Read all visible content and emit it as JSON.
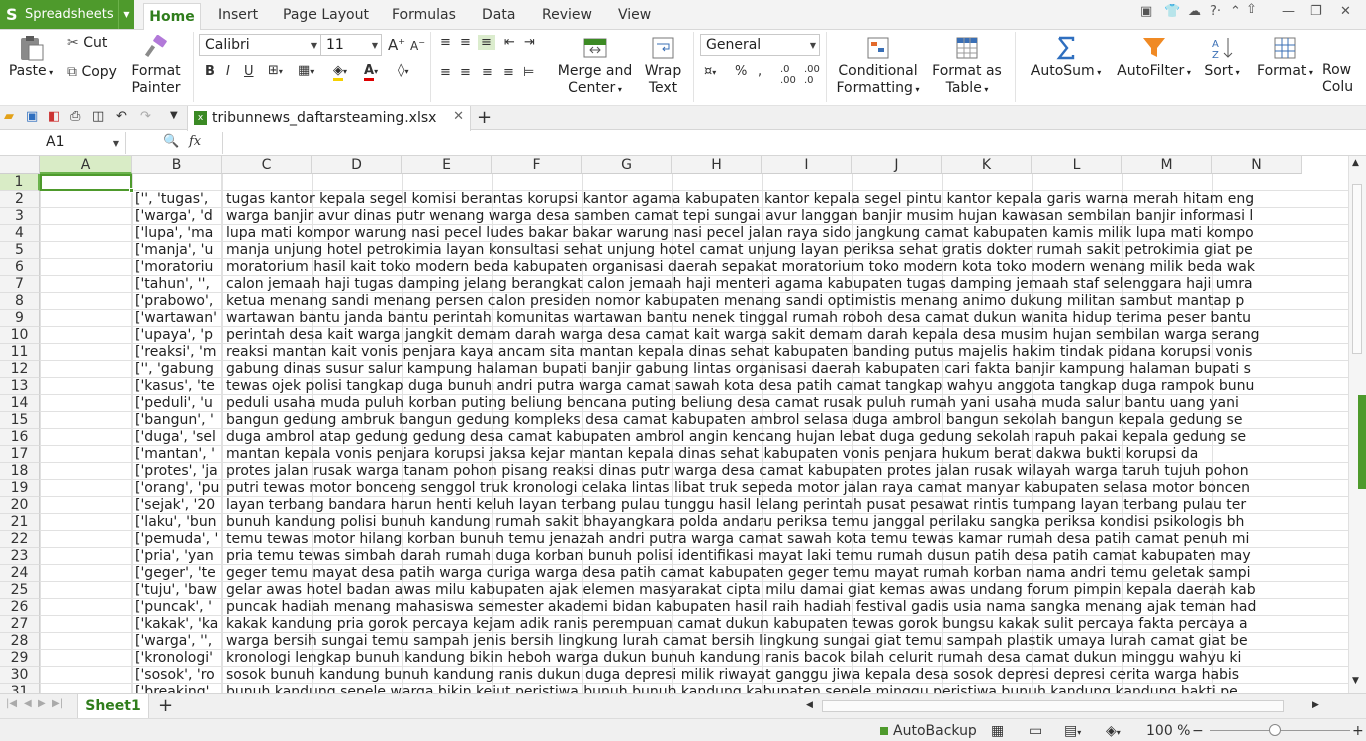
{
  "app": {
    "name": "Spreadsheets",
    "logo_letter": "S"
  },
  "menu": {
    "tabs": [
      "Home",
      "Insert",
      "Page Layout",
      "Formulas",
      "Data",
      "Review",
      "View"
    ],
    "active": "Home"
  },
  "ribbon": {
    "paste": "Paste",
    "cut": "Cut",
    "copy": "Copy",
    "format_painter_1": "Format",
    "format_painter_2": "Painter",
    "font_name": "Calibri",
    "font_size": "11",
    "merge_1": "Merge and",
    "merge_2": "Center",
    "wrap_1": "Wrap",
    "wrap_2": "Text",
    "number_format": "General",
    "cond_1": "Conditional",
    "cond_2": "Formatting",
    "fmt_table_1": "Format as",
    "fmt_table_2": "Table",
    "autosum": "AutoSum",
    "autofilter": "AutoFilter",
    "sort": "Sort",
    "format": "Format",
    "rows_cols_1": "Row",
    "rows_cols_2": "Colu"
  },
  "document": {
    "filename": "tribunnews_daftarsteaming.xlsx"
  },
  "formula_bar": {
    "cell_ref": "A1",
    "fx": "fx",
    "value": ""
  },
  "columns": [
    "A",
    "B",
    "C",
    "D",
    "E",
    "F",
    "G",
    "H",
    "I",
    "J",
    "K",
    "L",
    "M",
    "N"
  ],
  "rows": [
    {
      "n": "1",
      "b": "",
      "c": ""
    },
    {
      "n": "2",
      "b": "['', 'tugas',",
      "c": "tugas kantor kepala segel komisi berantas korupsi kantor agama kabupaten kantor kepala segel pintu kantor kepala garis warna merah hitam eng"
    },
    {
      "n": "3",
      "b": "['warga', 'd",
      "c": "warga banjir avur dinas putr wenang warga desa samben camat tepi sungai avur langgan banjir musim hujan kawasan sembilan banjir informasi l"
    },
    {
      "n": "4",
      "b": "['lupa', 'ma",
      "c": "lupa mati kompor warung nasi pecel ludes bakar bakar warung nasi pecel jalan raya sido jangkung camat kabupaten kamis milik lupa mati kompo"
    },
    {
      "n": "5",
      "b": "['manja', 'u",
      "c": "manja unjung hotel petrokimia layan konsultasi sehat unjung hotel camat unjung layan periksa sehat gratis dokter rumah sakit petrokimia giat pe"
    },
    {
      "n": "6",
      "b": "['moratoriu",
      "c": "moratorium hasil kait toko modern beda kabupaten organisasi daerah sepakat moratorium toko modern kota toko modern wenang milik beda wak"
    },
    {
      "n": "7",
      "b": "['tahun', '',",
      "c": "calon jemaah haji tugas damping jelang berangkat calon jemaah haji menteri agama kabupaten tugas damping jemaah staf selenggara haji umra"
    },
    {
      "n": "8",
      "b": "['prabowo',",
      "c": "ketua menang sandi menang persen calon presiden nomor kabupaten menang sandi optimistis menang animo dukung militan sambut mantap p"
    },
    {
      "n": "9",
      "b": "['wartawan'",
      "c": "wartawan bantu janda bantu perintah komunitas wartawan bantu nenek tinggal rumah roboh desa camat dukun wanita hidup terima peser bantu"
    },
    {
      "n": "10",
      "b": "['upaya', 'p",
      "c": "perintah desa kait warga jangkit demam darah warga desa camat kait warga sakit demam darah kepala desa musim hujan sembilan warga serang"
    },
    {
      "n": "11",
      "b": "['reaksi', 'm",
      "c": "reaksi mantan kait vonis penjara kaya ancam sita mantan kepala dinas sehat kabupaten banding putus majelis hakim tindak pidana korupsi vonis"
    },
    {
      "n": "12",
      "b": "['', 'gabung",
      "c": "gabung dinas susur salur kampung halaman bupati banjir gabung lintas organisasi daerah kabupaten cari fakta banjir kampung halaman bupati s"
    },
    {
      "n": "13",
      "b": "['kasus', 'te",
      "c": "tewas ojek polisi tangkap duga bunuh andri putra warga camat sawah kota desa patih camat tangkap wahyu anggota tangkap duga rampok bunu"
    },
    {
      "n": "14",
      "b": "['peduli', 'u",
      "c": "peduli usaha muda puluh korban puting beliung bencana puting beliung desa camat rusak puluh rumah yani usaha muda salur bantu uang yani"
    },
    {
      "n": "15",
      "b": "['bangun', '",
      "c": "bangun gedung ambruk bangun gedung kompleks desa camat kabupaten ambrol selasa duga ambrol bangun sekolah bangun kepala gedung se"
    },
    {
      "n": "16",
      "b": "['duga', 'sel",
      "c": "duga ambrol atap gedung gedung desa camat kabupaten ambrol angin kencang hujan lebat duga gedung sekolah rapuh pakai kepala gedung se"
    },
    {
      "n": "17",
      "b": "['mantan', '",
      "c": "mantan kepala vonis penjara korupsi jaksa kejar mantan kepala dinas sehat kabupaten vonis penjara hukum berat dakwa bukti korupsi da"
    },
    {
      "n": "18",
      "b": "['protes', 'ja",
      "c": "protes jalan rusak warga tanam pohon pisang reaksi dinas putr warga desa camat kabupaten protes jalan rusak wilayah warga taruh tujuh pohon"
    },
    {
      "n": "19",
      "b": "['orang', 'pu",
      "c": "putri tewas motor bonceng senggol truk kronologi celaka lintas libat truk sepeda motor jalan raya camat manyar kabupaten selasa motor boncen"
    },
    {
      "n": "20",
      "b": "['sejak', '20",
      "c": "layan terbang bandara harun henti keluh layan terbang pulau tunggu hasil lelang perintah pusat pesawat rintis tumpang layan terbang pulau ter"
    },
    {
      "n": "21",
      "b": "['laku', 'bun",
      "c": "bunuh kandung polisi bunuh kandung rumah sakit bhayangkara polda andaru periksa temu janggal perilaku sangka periksa kondisi psikologis bh"
    },
    {
      "n": "22",
      "b": "['pemuda', '",
      "c": "temu tewas motor hilang korban bunuh temu jenazah andri putra warga camat sawah kota temu tewas kamar rumah desa patih camat penuh mi"
    },
    {
      "n": "23",
      "b": "['pria', 'yan",
      "c": "pria temu tewas simbah darah rumah duga korban bunuh polisi identifikasi mayat laki temu rumah dusun patih desa patih camat kabupaten may"
    },
    {
      "n": "24",
      "b": "['geger', 'te",
      "c": "geger temu mayat desa patih warga curiga warga desa patih camat kabupaten geger temu mayat rumah korban nama andri temu geletak sampi"
    },
    {
      "n": "25",
      "b": "['tuju', 'baw",
      "c": "gelar awas hotel badan awas milu kabupaten ajak elemen masyarakat cipta milu damai giat kemas awas undang forum pimpin kepala daerah kab"
    },
    {
      "n": "26",
      "b": "['puncak', '",
      "c": "puncak hadiah menang mahasiswa semester akademi bidan kabupaten hasil raih hadiah festival gadis usia nama sangka menang ajak teman had"
    },
    {
      "n": "27",
      "b": "['kakak', 'ka",
      "c": "kakak kandung pria gorok percaya kejam adik ranis perempuan camat dukun kabupaten tewas gorok bungsu kakak sulit percaya fakta percaya a"
    },
    {
      "n": "28",
      "b": "['warga', '',",
      "c": "warga bersih sungai temu sampah jenis bersih lingkung lurah camat bersih lingkung sungai giat temu sampah plastik umaya lurah camat giat be"
    },
    {
      "n": "29",
      "b": "['kronologi'",
      "c": "kronologi lengkap bunuh kandung bikin heboh warga dukun bunuh kandung ranis bacok bilah celurit rumah desa camat dukun minggu wahyu ki"
    },
    {
      "n": "30",
      "b": "['sosok', 'ro",
      "c": "sosok bunuh kandung bunuh kandung ranis dukun duga depresi milik riwayat ganggu jiwa kepala desa sosok depresi depresi cerita warga habis"
    },
    {
      "n": "31",
      "b": "['breaking',",
      "c": "bunuh kandung sepele warga bikin kejut peristiwa bunuh bunuh kandung kabupaten sepele minggu peristiwa bunuh kandung kandung hakti pe"
    }
  ],
  "sheets": {
    "active": "Sheet1",
    "add": "+"
  },
  "status": {
    "autobackup": "AutoBackup",
    "zoom": "100 %"
  },
  "colors": {
    "accent": "#4e9a2c",
    "selection_header": "#d9ecc6"
  }
}
